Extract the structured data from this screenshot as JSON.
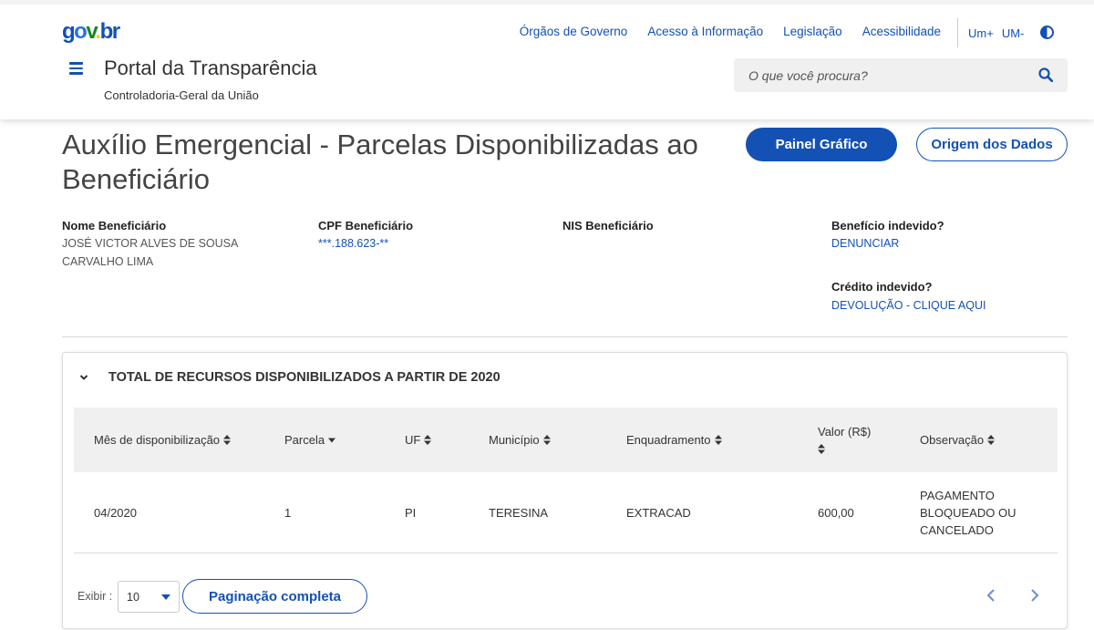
{
  "header": {
    "logo": {
      "g": "g",
      "o": "o",
      "v": "v",
      "dot": ".",
      "br": "br"
    },
    "links": [
      "Órgãos de Governo",
      "Acesso à Informação",
      "Legislação",
      "Acessibilidade"
    ],
    "font_increase": "Um+",
    "font_decrease": "UM-",
    "portal_title": "Portal da Transparência",
    "portal_subtitle": "Controladoria-Geral da União",
    "search_placeholder": "O que você procura?",
    "brand_color": "#1351b4"
  },
  "page": {
    "title": "Auxílio Emergencial - Parcelas Disponibilizadas ao Beneficiário",
    "btn_painel": "Painel Gráfico",
    "btn_origem": "Origem dos Dados"
  },
  "beneficiary": {
    "name_label": "Nome Beneficiário",
    "name_value": "JOSÉ VICTOR ALVES DE SOUSA CARVALHO LIMA",
    "cpf_label": "CPF Beneficiário",
    "cpf_value": "***.188.623-**",
    "nis_label": "NIS Beneficiário",
    "beneficio_label": "Benefício indevido?",
    "beneficio_link": "DENUNCIAR",
    "credito_label": "Crédito indevido?",
    "credito_link": "DEVOLUÇÃO - CLIQUE AQUI"
  },
  "card": {
    "title": "TOTAL DE RECURSOS DISPONIBILIZADOS A PARTIR DE 2020",
    "columns": [
      "Mês de disponibilização",
      "Parcela",
      "UF",
      "Município",
      "Enquadramento",
      "Valor (R$)",
      "Observação"
    ],
    "rows": [
      {
        "mes": "04/2020",
        "parcela": "1",
        "uf": "PI",
        "municipio": "TERESINA",
        "enquadramento": "EXTRACAD",
        "valor": "600,00",
        "observacao": "PAGAMENTO BLOQUEADO OU CANCELADO"
      }
    ],
    "exibir_label": "Exibir :",
    "page_size": "10",
    "btn_paginacao": "Paginação completa"
  }
}
